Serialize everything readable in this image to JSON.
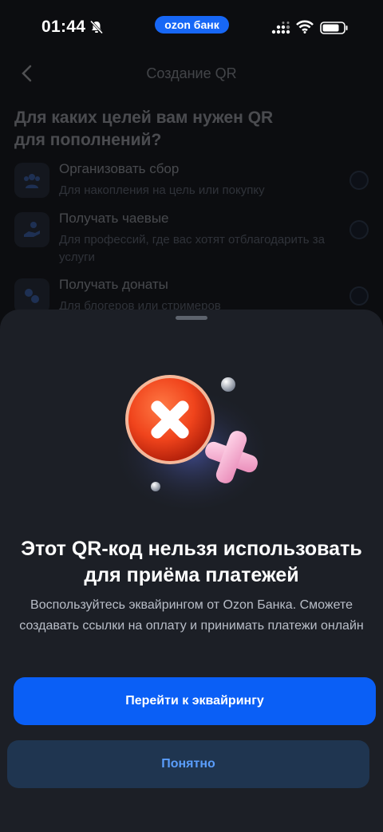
{
  "status_bar": {
    "time": "01:44",
    "bank_pill": "ozon банк"
  },
  "header": {
    "title": "Создание QR"
  },
  "question": "Для каких целей вам нужен QR для пополнений?",
  "options": [
    {
      "title": "Организовать сбор",
      "subtitle": "Для накопления на цель или покупку",
      "icon": "people-icon"
    },
    {
      "title": "Получать чаевые",
      "subtitle": "Для профессий, где вас хотят отблагодарить за услуги",
      "icon": "tip-hand-icon"
    },
    {
      "title": "Получать донаты",
      "subtitle": "Для блогеров или стримеров",
      "icon": "donate-icon"
    }
  ],
  "sheet": {
    "title": "Этот QR-код нельзя использовать для приёма платежей",
    "subtitle": "Воспользуйтесь эквайрингом от Ozon Банка. Сможете создавать ссылки на оплату и принимать платежи онлайн",
    "primary_button": "Перейти к эквайрингу",
    "secondary_button": "Понятно"
  },
  "colors": {
    "accent": "#0A5FF6",
    "sheet_bg": "#1C1F26",
    "secondary_text": "#5A9DFB"
  }
}
